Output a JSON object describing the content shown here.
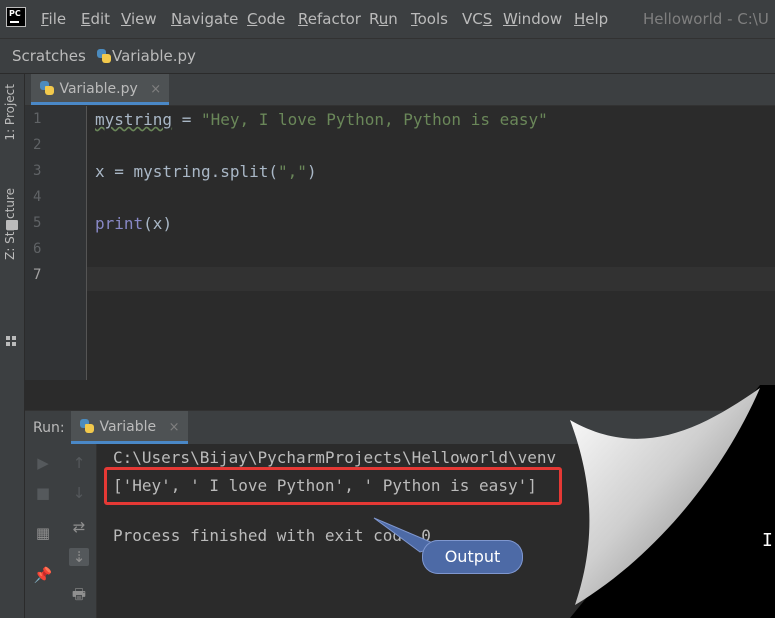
{
  "menubar": {
    "items": [
      {
        "prefix": "",
        "key": "F",
        "rest": "ile"
      },
      {
        "prefix": "",
        "key": "E",
        "rest": "dit"
      },
      {
        "prefix": "",
        "key": "V",
        "rest": "iew"
      },
      {
        "prefix": "",
        "key": "N",
        "rest": "avigate"
      },
      {
        "prefix": "",
        "key": "C",
        "rest": "ode"
      },
      {
        "prefix": "",
        "key": "R",
        "rest": "efactor"
      },
      {
        "prefix": "R",
        "key": "u",
        "rest": "n"
      },
      {
        "prefix": "",
        "key": "T",
        "rest": "ools"
      },
      {
        "prefix": "VC",
        "key": "S",
        "rest": ""
      },
      {
        "prefix": "",
        "key": "W",
        "rest": "indow"
      },
      {
        "prefix": "",
        "key": "H",
        "rest": "elp"
      }
    ],
    "window_title": "Helloworld - C:\\U",
    "logo_text": "PC"
  },
  "breadcrumbs": [
    "Scratches",
    "Variable.py"
  ],
  "sidebar": {
    "project_tab": "1: Project",
    "structure_tab": "Z: Structure"
  },
  "editor": {
    "tab_label": "Variable.py",
    "tab_close": "×",
    "line_numbers": [
      "1",
      "2",
      "3",
      "4",
      "5",
      "6",
      "7"
    ],
    "current_line": "7",
    "code": {
      "line1_var": "mystring",
      "line1_op": " = ",
      "line1_str": "\"Hey, I love Python, Python is easy\"",
      "line3_pre": "x = mystring.split(",
      "line3_str": "\",\"",
      "line3_post": ")",
      "line5_fn": "print",
      "line5_rest": "(x)"
    }
  },
  "run_panel": {
    "label": "Run:",
    "tab_label": "Variable",
    "tab_close": "×",
    "console": {
      "path_line": "C:\\Users\\Bijay\\PycharmProjects\\Helloworld\\venv",
      "output_line": "['Hey', ' I love Python', ' Python is easy']",
      "exit_line": "Process finished with exit code 0"
    },
    "toolbar_glyphs": {
      "rerun": "▶",
      "up": "↑",
      "stop": "■",
      "down": "↓",
      "soft_wrap": "⇄",
      "layout": "▦",
      "scroll_end": "⇣",
      "pin": "📌",
      "print": "🖶"
    }
  },
  "annotation": {
    "callout_text": "Output",
    "highlight_color": "#e53935",
    "callout_color": "#4d6aa6"
  },
  "colors": {
    "editor_bg": "#2b2b2b",
    "chrome_bg": "#3c3f41",
    "string": "#6a8759",
    "builtin": "#8888c6",
    "text": "#a9b7c6",
    "accent_tab": "#4a88c7"
  },
  "cursor_glyph": "I"
}
